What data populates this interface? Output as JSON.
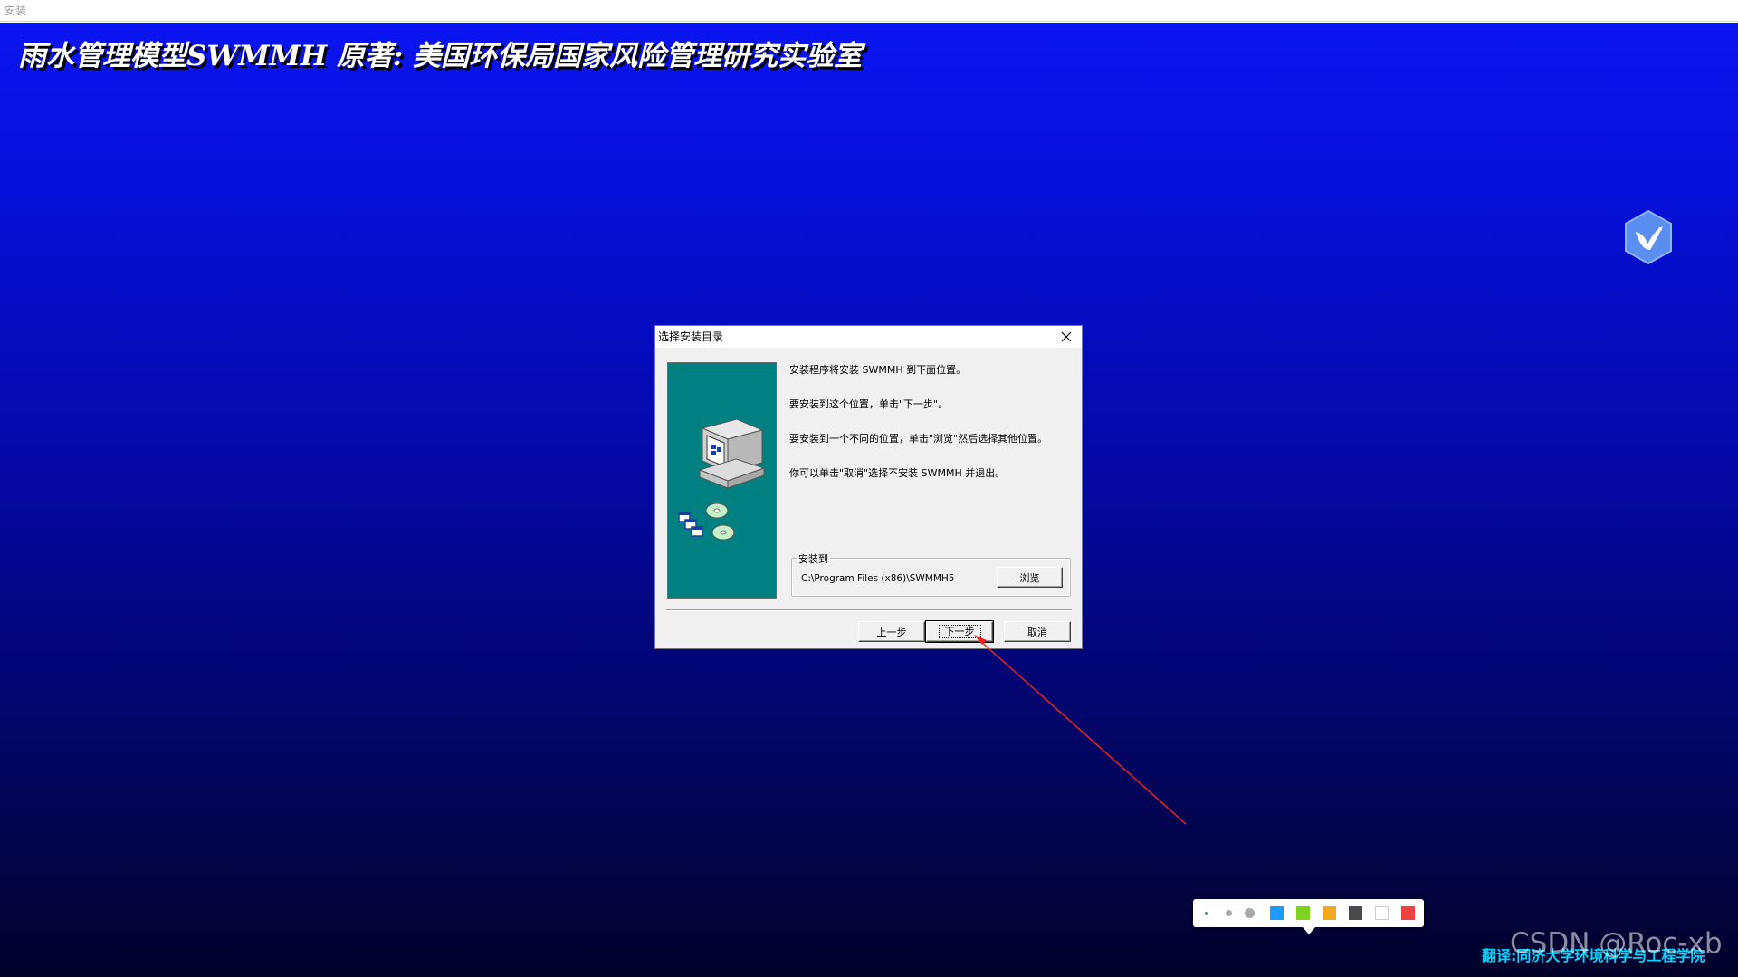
{
  "window": {
    "title": "安装"
  },
  "banner": {
    "title": "雨水管理模型SWMMH  原著: 美国环保局国家风险管理研究实验室"
  },
  "dialog": {
    "title": "选择安装目录",
    "messages": [
      "安装程序将安装 SWMMH 到下面位置。",
      "要安装到这个位置，单击\"下一步\"。",
      "要安装到一个不同的位置，单击\"浏览\"然后选择其他位置。",
      "你可以单击\"取消\"选择不安装 SWMMH 并退出。"
    ],
    "install_group": {
      "label": "安装到",
      "path": "C:\\Program Files (x86)\\SWMMH5",
      "browse_label": "浏览"
    },
    "buttons": {
      "back": "上一步",
      "next": "下一步",
      "cancel": "取消"
    }
  },
  "color_toolbar": {
    "swatches": [
      "#1e9bff",
      "#7ed321",
      "#f5a623",
      "#4a4a4a",
      "#ffffff",
      "#f04040"
    ]
  },
  "footer": {
    "translator_credit": "翻译:同济大学环境科学与工程学院",
    "watermark": "CSDN @Roc-xb"
  },
  "colors": {
    "background_top": "#0a14f0",
    "background_bottom": "#01022a",
    "side_panel": "#008080",
    "annotation_arrow": "#e8261e"
  }
}
